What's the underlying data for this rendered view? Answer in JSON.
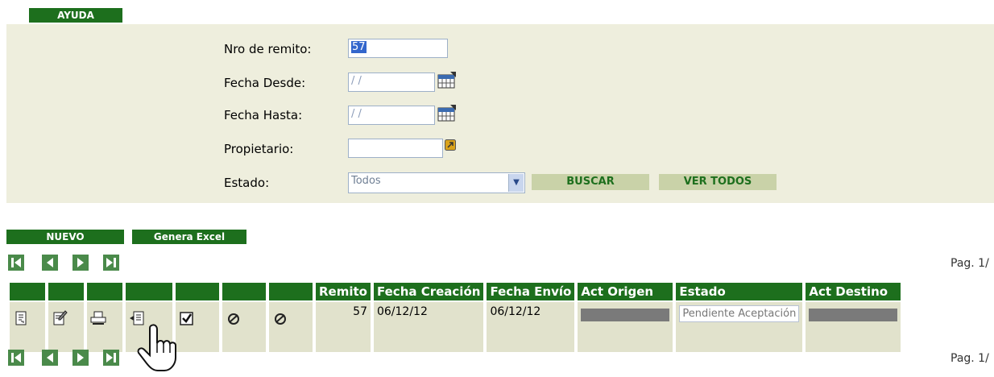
{
  "help_button": "AYUDA",
  "search": {
    "remito_label": "Nro de remito:",
    "remito_value": "57",
    "fecha_desde_label": "Fecha Desde:",
    "fecha_desde_value": "/ /",
    "fecha_hasta_label": "Fecha Hasta:",
    "fecha_hasta_value": "/ /",
    "propietario_label": "Propietario:",
    "propietario_value": "",
    "estado_label": "Estado:",
    "estado_selected": "Todos",
    "buscar_button": "BUSCAR",
    "ver_todos_button": "VER TODOS"
  },
  "toolbar": {
    "nuevo_button": "NUEVO",
    "excel_button": "Genera Excel"
  },
  "pagination": {
    "top_text": "Pag. 1/",
    "bottom_text": "Pag. 1/"
  },
  "table": {
    "columns": [
      "",
      "",
      "",
      "",
      "",
      "",
      "",
      "Remito",
      "Fecha Creación",
      "Fecha Envío",
      "Act Origen",
      "Estado",
      "Act Destino"
    ],
    "row": {
      "remito": "57",
      "fecha_creacion": "06/12/12",
      "fecha_envio": "06/12/12",
      "estado": "Pendiente Aceptación"
    },
    "action_icons": [
      "view-document-icon",
      "edit-icon",
      "print-icon",
      "send-icon",
      "checkbox-icon",
      "cancel-icon",
      "cancel-icon"
    ]
  },
  "colors": {
    "primary_green": "#1d6f1d",
    "panel_bg": "#eeeedd",
    "row_bg": "#e1e2cc"
  }
}
